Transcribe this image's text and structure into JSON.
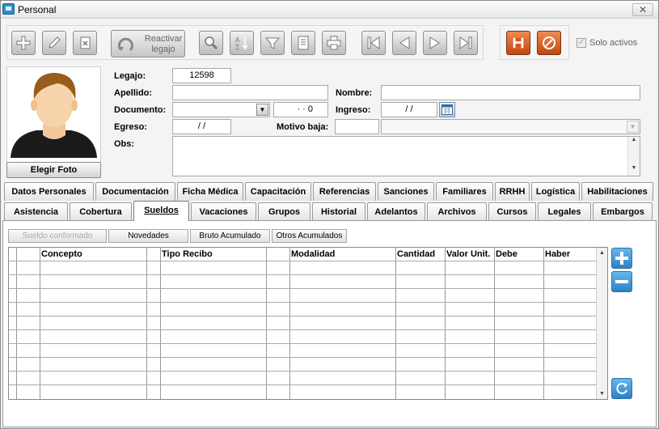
{
  "window": {
    "title": "Personal",
    "close_glyph": "✕"
  },
  "toolbar": {
    "reactivar_line1": "Reactivar",
    "reactivar_line2": "legajo",
    "icons": [
      "add-icon",
      "edit-icon",
      "delete-icon",
      "reactivate-icon",
      "search-icon",
      "sort-az-icon",
      "filter-icon",
      "report-icon",
      "print-icon",
      "first-record-icon",
      "previous-record-icon",
      "next-record-icon",
      "last-record-icon",
      "save-icon",
      "cancel-icon"
    ]
  },
  "solo_activos": {
    "label": "Solo activos",
    "checked": true
  },
  "photo": {
    "button": "Elegir Foto"
  },
  "form": {
    "legajo_label": "Legajo:",
    "legajo_value": "12598",
    "apellido_label": "Apellido:",
    "apellido_value": "",
    "nombre_label": "Nombre:",
    "nombre_value": "",
    "documento_label": "Documento:",
    "documento_tipo": "",
    "documento_numero": "·  ·  0",
    "ingreso_label": "Ingreso:",
    "ingreso_value": "/ /",
    "egreso_label": "Egreso:",
    "egreso_value": "/ /",
    "motivo_label": "Motivo baja:",
    "motivo_code": "",
    "motivo_desc": "",
    "obs_label": "Obs:",
    "obs_value": ""
  },
  "tabs_row1": [
    "Datos Personales",
    "Documentación",
    "Ficha Médica",
    "Capacitación",
    "Referencias",
    "Sanciones",
    "Familiares",
    "RRHH",
    "Logística",
    "Habilitaciones"
  ],
  "tabs_row2": [
    "Asistencia",
    "Cobertura",
    "Sueldos",
    "Vacaciones",
    "Grupos",
    "Historial",
    "Adelantos",
    "Archivos",
    "Cursos",
    "Legales",
    "Embargos"
  ],
  "active_tab": "Sueldos",
  "subtabs": [
    "Sueldo conformado",
    "Novedades",
    "Bruto Acumulado",
    "Otros Acumulados"
  ],
  "grid": {
    "columns": [
      "Concepto",
      "Tipo Recibo",
      "Modalidad",
      "Cantidad",
      "Valor Unit.",
      "Debe",
      "Haber"
    ],
    "rows": []
  },
  "colors": {
    "accent_orange": "#d9571f",
    "accent_blue": "#2a82c6"
  }
}
